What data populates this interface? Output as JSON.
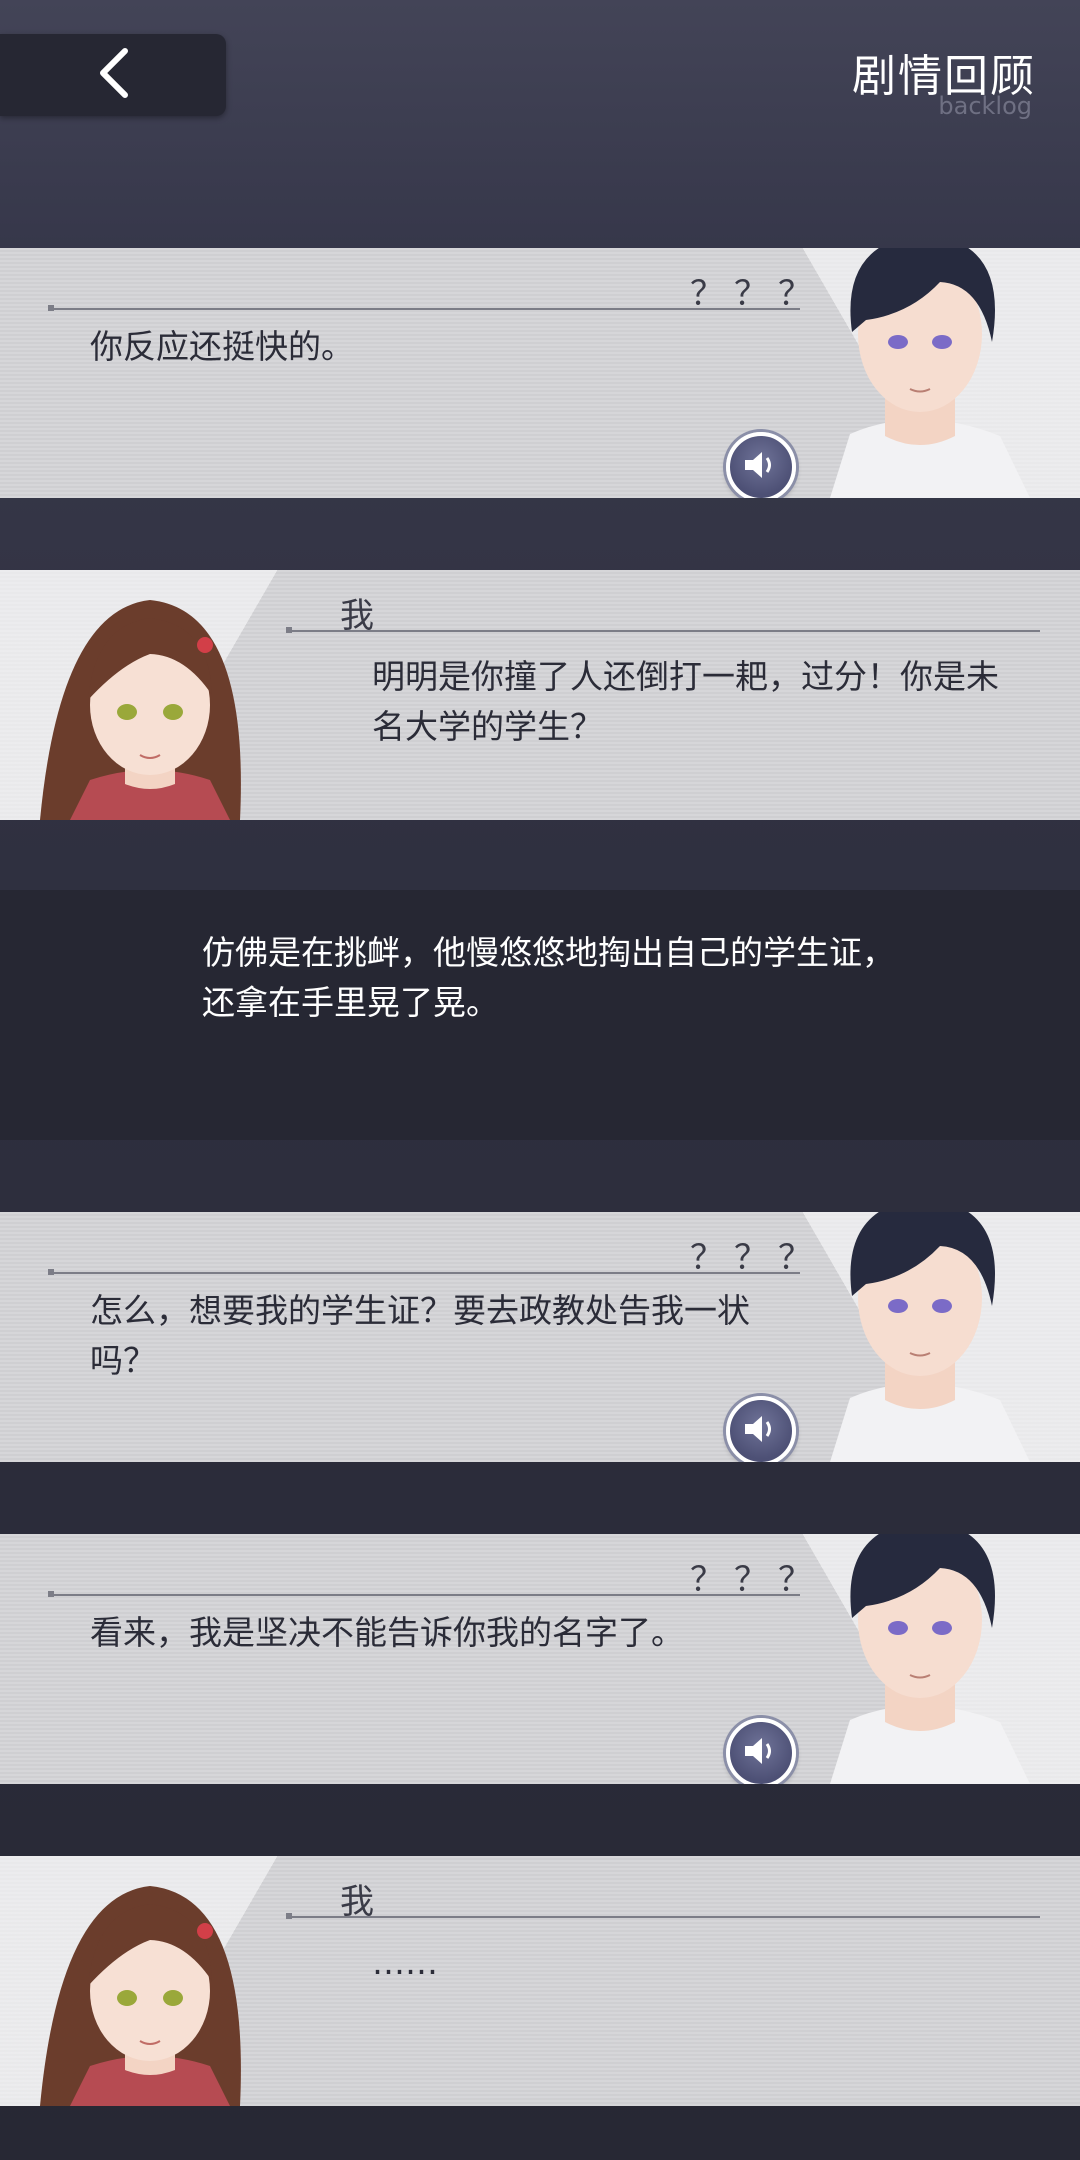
{
  "header": {
    "title": "剧情回顾",
    "subtitle": "backlog",
    "back_icon": "chevron-left-icon"
  },
  "entries": [
    {
      "speaker": "？？？",
      "text": "你反应还挺快的。",
      "side": "right",
      "voice": "speaker-icon"
    },
    {
      "speaker": "我",
      "text": "明明是你撞了人还倒打一耙，过分！你是未名大学的学生？",
      "side": "left"
    },
    {
      "narration": "仿佛是在挑衅，他慢悠悠地掏出自己的学生证，还拿在手里晃了晃。"
    },
    {
      "speaker": "？？？",
      "text": "怎么，想要我的学生证？要去政教处告我一状吗？",
      "side": "right",
      "voice": "speaker-icon"
    },
    {
      "speaker": "？？？",
      "text": "看来，我是坚决不能告诉你我的名字了。",
      "side": "right",
      "voice": "speaker-icon"
    },
    {
      "speaker": "我",
      "text": "……",
      "side": "left"
    }
  ],
  "colors": {
    "hair_male": "#262a3e",
    "hair_female": "#6b3d2c",
    "eyes_male": "#7b6bc7",
    "eyes_female": "#9aa83a"
  }
}
